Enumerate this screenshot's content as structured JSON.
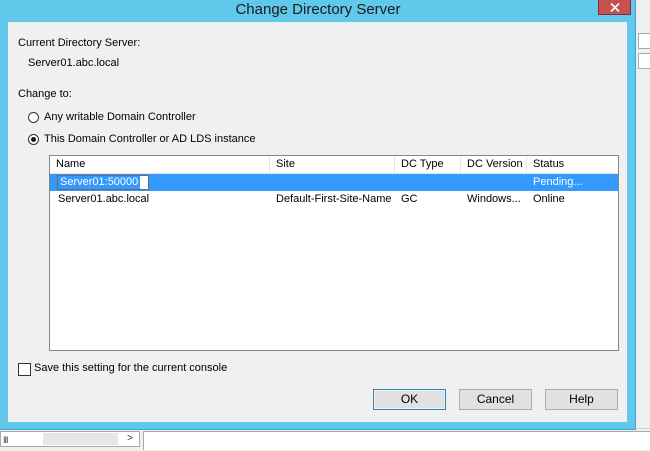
{
  "window": {
    "title": "Change Directory Server"
  },
  "current_server": {
    "label": "Current Directory Server:",
    "value": "Server01.abc.local"
  },
  "change_to": {
    "label": "Change to:",
    "options": [
      {
        "label": "Any writable Domain Controller",
        "selected": false
      },
      {
        "label": "This Domain Controller or AD LDS instance",
        "selected": true
      }
    ]
  },
  "list": {
    "columns": [
      "Name",
      "Site",
      "DC Type",
      "DC Version",
      "Status"
    ],
    "rows": [
      {
        "name": "Server01:50000",
        "site": "",
        "dc_type": "",
        "dc_version": "",
        "status": "Pending...",
        "selected": true,
        "editing": true
      },
      {
        "name": "Server01.abc.local",
        "site": "Default-First-Site-Name",
        "dc_type": "GC",
        "dc_version": "Windows...",
        "status": "Online",
        "selected": false
      }
    ]
  },
  "save_setting": {
    "label": "Save this setting for the current console",
    "checked": false
  },
  "buttons": {
    "ok": "OK",
    "cancel": "Cancel",
    "help": "Help"
  },
  "background": {
    "scroll_right_glyph": ">",
    "scroll_grip": "III"
  },
  "colors": {
    "titlebar": "#60c8eb",
    "selection": "#3399ff",
    "close": "#c75050"
  }
}
